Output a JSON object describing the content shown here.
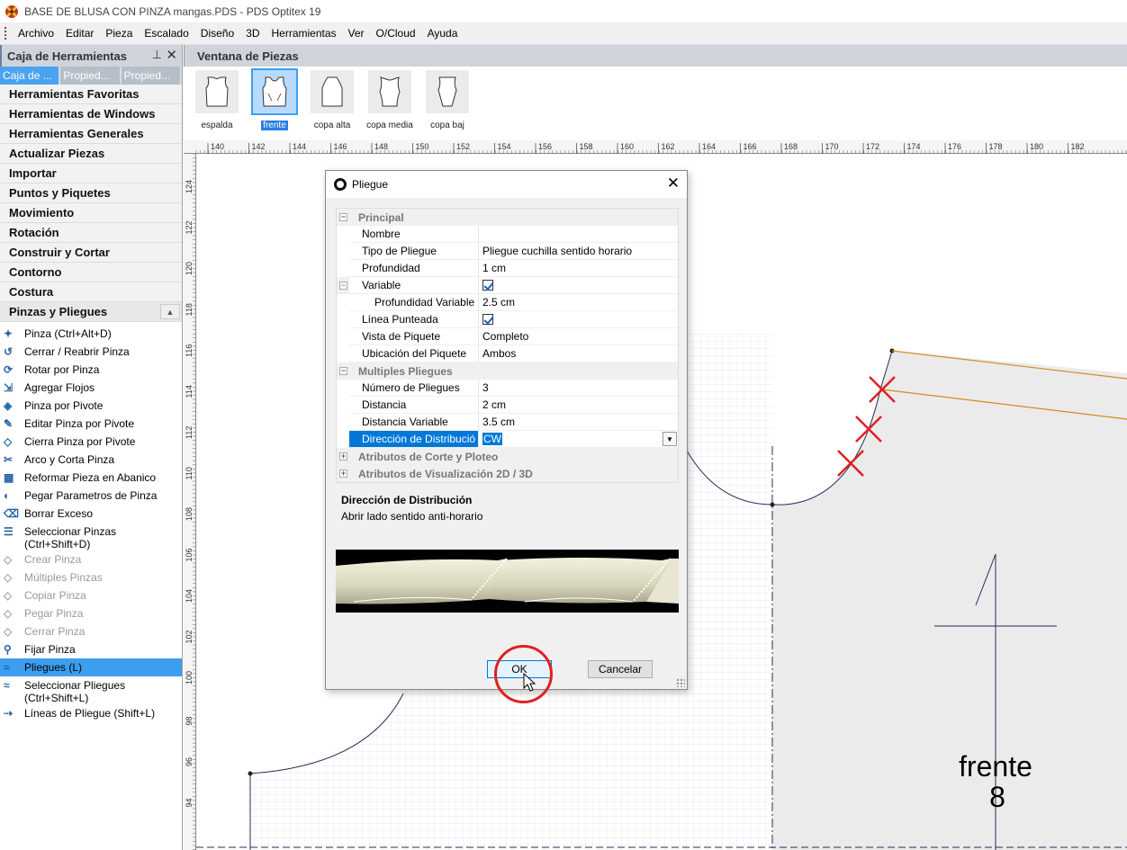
{
  "titlebar": {
    "title": "BASE DE BLUSA CON PINZA mangas.PDS - PDS Optitex 19"
  },
  "menubar": {
    "items": [
      "Archivo",
      "Editar",
      "Pieza",
      "Escalado",
      "Diseño",
      "3D",
      "Herramientas",
      "Ver",
      "O/Cloud",
      "Ayuda"
    ]
  },
  "toolbox": {
    "title": "Caja de Herramientas",
    "pin": "⊥",
    "close": "✕",
    "tabs": [
      "Caja de ...",
      "Propied...",
      "Propied..."
    ],
    "categories": [
      "Herramientas Favoritas",
      "Herramientas de Windows",
      "Herramientas Generales",
      "Actualizar Piezas",
      "Importar",
      "Puntos y Piquetes",
      "Movimiento",
      "Rotación",
      "Construir y Cortar",
      "Contorno",
      "Costura",
      "Pinzas y Pliegues"
    ],
    "tools": [
      {
        "label": "Pinza (Ctrl+Alt+D)",
        "icon": "dart-icon"
      },
      {
        "label": "Cerrar / Reabrir Pinza",
        "icon": "close-dart-icon"
      },
      {
        "label": "Rotar por Pinza",
        "icon": "rotate-dart-icon"
      },
      {
        "label": "Agregar Flojos",
        "icon": "add-ease-icon"
      },
      {
        "label": "Pinza por Pivote",
        "icon": "pivot-dart-icon"
      },
      {
        "label": "Editar Pinza por Pivote",
        "icon": "edit-pivot-dart-icon"
      },
      {
        "label": "Cierra Pinza por Pivote",
        "icon": "close-pivot-dart-icon"
      },
      {
        "label": "Arco y Corta Pinza",
        "icon": "arc-cut-dart-icon"
      },
      {
        "label": "Reformar Pieza en Abanico",
        "icon": "fan-icon"
      },
      {
        "label": "Pegar Parametros de Pinza",
        "icon": "paste-dart-params-icon"
      },
      {
        "label": "Borrar Exceso",
        "icon": "erase-excess-icon"
      },
      {
        "label": "Seleccionar Pinzas\n(Ctrl+Shift+D)",
        "icon": "select-darts-icon"
      },
      {
        "label": "Crear Pinza",
        "icon": "create-dart-icon"
      },
      {
        "label": "Múltiples Pinzas",
        "icon": "multiple-darts-icon"
      },
      {
        "label": "Copiar Pinza",
        "icon": "copy-dart-icon"
      },
      {
        "label": "Pegar Pinza",
        "icon": "paste-dart-icon"
      },
      {
        "label": "Cerrar Pinza",
        "icon": "close-dart2-icon"
      },
      {
        "label": "Fijar Pinza",
        "icon": "fix-dart-icon"
      },
      {
        "label": "Pliegues (L)",
        "icon": "pleats-icon"
      },
      {
        "label": "Seleccionar Pliegues\n(Ctrl+Shift+L)",
        "icon": "select-pleats-icon"
      },
      {
        "label": "Líneas de Pliegue (Shift+L)",
        "icon": "pleat-lines-icon"
      }
    ]
  },
  "pieces": {
    "title": "Ventana de Piezas",
    "items": [
      "espalda",
      "frente",
      "copa alta",
      "copa media",
      "copa baj"
    ]
  },
  "rulers": {
    "h_labels": [
      "140",
      "142",
      "144",
      "146",
      "148",
      "150",
      "152",
      "154",
      "156",
      "158",
      "160",
      "162",
      "164",
      "166",
      "168",
      "170",
      "172",
      "174",
      "176",
      "178",
      "180",
      "182"
    ],
    "v_labels": [
      "124",
      "122",
      "120",
      "118",
      "116",
      "114",
      "112",
      "110",
      "108",
      "106",
      "104",
      "102",
      "100",
      "98",
      "96",
      "94"
    ]
  },
  "canvas": {
    "piece_name": "frente",
    "piece_number": "8"
  },
  "dialog": {
    "title": "Pliegue",
    "close": "✕",
    "sections": {
      "principal": "Principal",
      "multiples": "Multiples Pliegues",
      "corte": "Atributos de Corte y Ploteo",
      "visual": "Atributos de Visualización 2D / 3D"
    },
    "props": {
      "nombre": {
        "name": "Nombre",
        "value": ""
      },
      "tipo": {
        "name": "Tipo de Pliegue",
        "value": "Pliegue cuchilla sentido horario"
      },
      "profundidad": {
        "name": "Profundidad",
        "value": "1 cm"
      },
      "variable": {
        "name": "Variable",
        "value": "checked"
      },
      "profvar": {
        "name": "Profundidad Variable",
        "value": "2.5 cm"
      },
      "linea": {
        "name": "Línea Punteada",
        "value": "checked"
      },
      "vista": {
        "name": "Vista de Piquete",
        "value": "Completo"
      },
      "ubicacion": {
        "name": "Ubicación del Piquete",
        "value": "Ambos"
      },
      "numero": {
        "name": "Número de Pliegues",
        "value": "3"
      },
      "distancia": {
        "name": "Distancia",
        "value": "2 cm"
      },
      "distvar": {
        "name": "Distancia Variable",
        "value": "3.5 cm"
      },
      "direccion": {
        "name": "Dirección de Distribució",
        "value": "CW"
      }
    },
    "description": {
      "title": "Dirección de Distribución",
      "text": "Abrir lado sentido anti-horario"
    },
    "ok": "OK",
    "cancel": "Cancelar"
  }
}
